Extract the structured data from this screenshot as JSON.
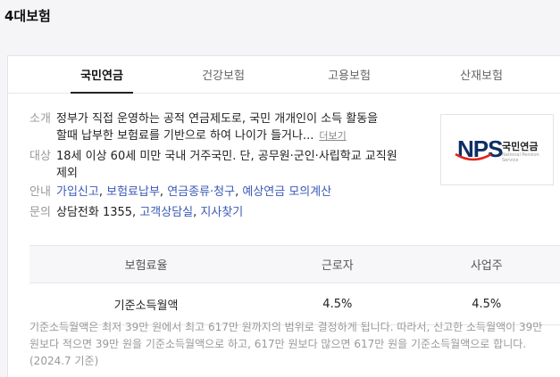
{
  "page_title": "4대보험",
  "tabs": [
    {
      "label": "국민연금",
      "active": true
    },
    {
      "label": "건강보험",
      "active": false
    },
    {
      "label": "고용보험",
      "active": false
    },
    {
      "label": "산재보험",
      "active": false
    }
  ],
  "intro": {
    "label": "소개",
    "line1": "정부가 직접 운영하는 공적 연금제도로, 국민 개개인이 소득 활동을",
    "line2": "할때 납부한 보험료를 기반으로 하여 나이가 들거나...",
    "more": "더보기"
  },
  "target": {
    "label": "대상",
    "line1": "18세 이상 60세 미만 국내 거주국민. 단, 공무원·군인·사립학교 교직원",
    "line2": "제외"
  },
  "guide": {
    "label": "안내",
    "links": [
      "가입신고",
      "보험료납부",
      "연금종류·청구",
      "예상연금 모의계산"
    ]
  },
  "contact": {
    "label": "문의",
    "phone": "상담전화 1355,",
    "links": [
      "고객상담실",
      "지사찾기"
    ]
  },
  "logo": {
    "mark": "NPS",
    "name": "국민연금",
    "sub": "National Pension Service"
  },
  "rates_table": {
    "headers": [
      "보험료율",
      "근로자",
      "사업주"
    ],
    "rows": [
      [
        "기준소득월액",
        "4.5%",
        "4.5%"
      ]
    ]
  },
  "footnote": "기준소득월액은 최저 39만 원에서 최고 617만 원까지의 범위로 결정하게 됩니다. 따라서, 신고한 소득월액이 39만 원보다 적으면 39만 원을 기준소득월액으로 하고, 617만 원보다 많으면 617만 원을 기준소득월액으로 합니다. (2024.7 기준)",
  "colors": {
    "link": "#3a5ab7",
    "logo_navy": "#0d2f64",
    "logo_red": "#e2231a"
  }
}
